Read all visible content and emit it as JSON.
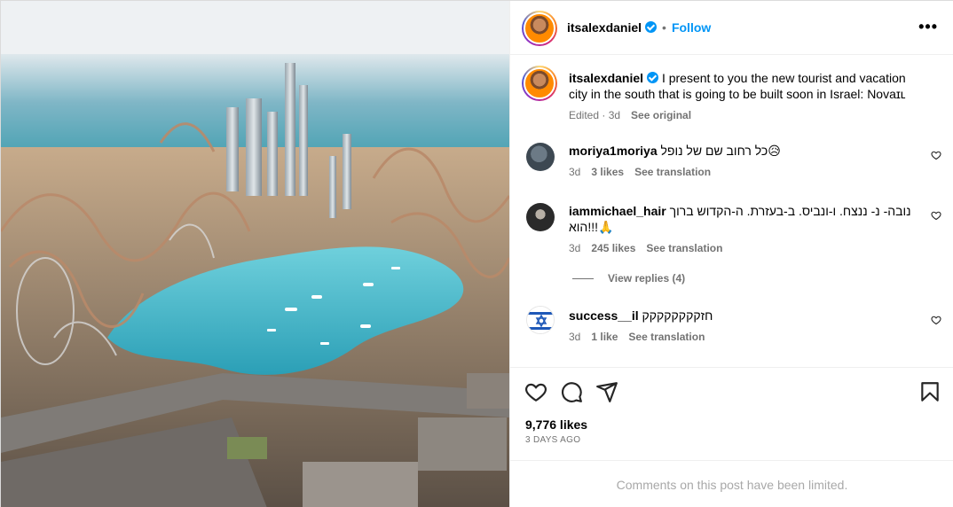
{
  "post": {
    "username": "itsalexdaniel",
    "follow_label": "Follow",
    "more_label": "•••",
    "caption": "I present to you the new tourist and vacation city in the south that is going to be built soon in Israel: Novaɪʟ",
    "caption_edited": "Edited · 3d",
    "caption_see_original": "See original",
    "likes": "9,776 likes",
    "date": "3 days ago",
    "comments_limited": "Comments on this post have been limited."
  },
  "comments": [
    {
      "username": "moriya1moriya",
      "text": "כל רחוב שם של נופל😥",
      "time": "3d",
      "likes": "3 likes",
      "translate": "See translation"
    },
    {
      "username": "iammichael_hair",
      "text": "נובה- נ- ננצח. ו-ונביס. ב-בעזרת. ה-הקדוש ברוך הוא!!!🙏",
      "time": "3d",
      "likes": "245 likes",
      "translate": "See translation"
    },
    {
      "username": "success__il",
      "text": "חזקקקקקקקק",
      "time": "3d",
      "likes": "1 like",
      "translate": "See translation"
    }
  ],
  "view_replies": "View replies (4)",
  "icons": {
    "like": "heart-icon",
    "comment": "comment-icon",
    "share": "share-icon",
    "save": "bookmark-icon",
    "verified": "verified-badge-icon",
    "more": "more-options-icon"
  },
  "colors": {
    "accent": "#0095f6",
    "secondary_text": "#737373",
    "muted_text": "#a8a8a8",
    "border": "#efefef"
  }
}
